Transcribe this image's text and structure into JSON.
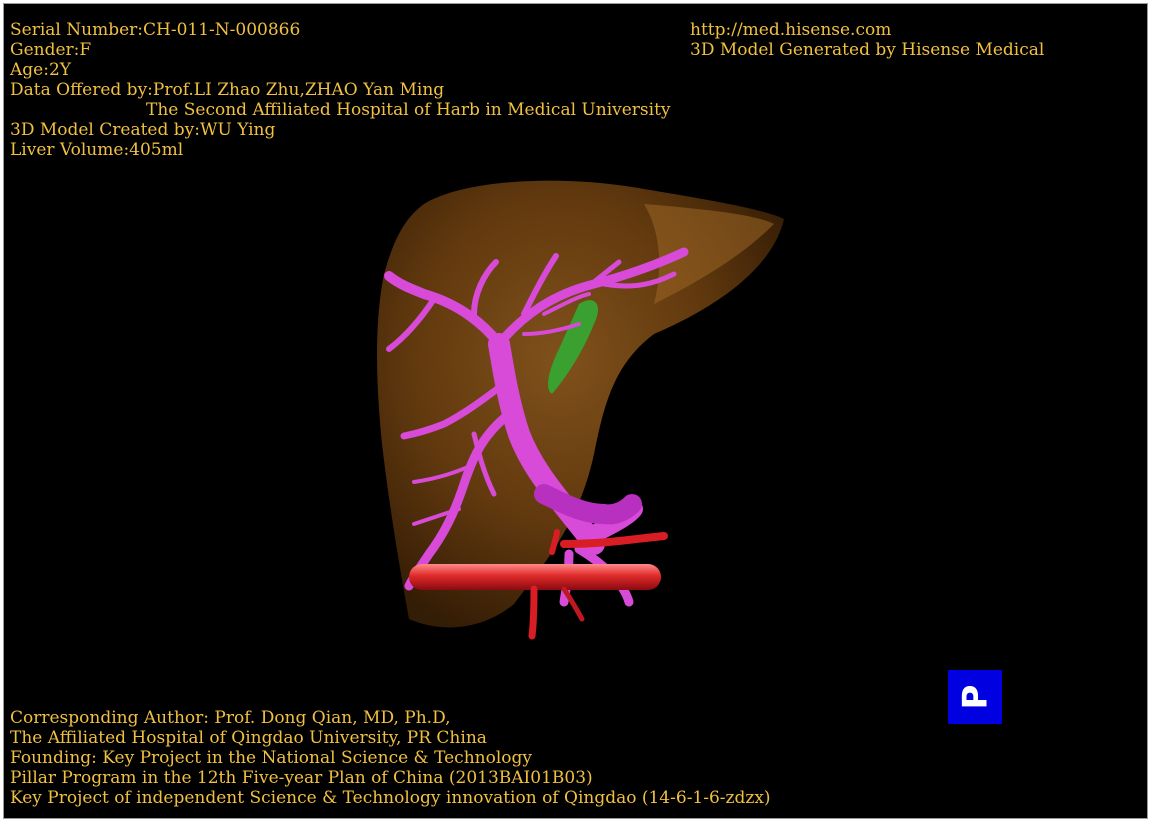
{
  "info_top_left": {
    "serial": "Serial Number:CH-011-N-000866",
    "gender": "Gender:F",
    "age": "Age:2Y",
    "data_offered": "Data Offered by:Prof.LI Zhao Zhu,ZHAO Yan Ming",
    "hospital": "The Second Affiliated Hospital of Harb in Medical University",
    "created_by": "3D Model Created by:WU Ying",
    "liver_volume": "Liver Volume:405ml"
  },
  "info_top_right": {
    "url": "http://med.hisense.com",
    "generated_by": "3D Model Generated by Hisense Medical"
  },
  "info_bottom_left": {
    "author": "Corresponding Author: Prof. Dong Qian, MD, Ph.D,",
    "affiliation": "The Affiliated Hospital of Qingdao University, PR China",
    "founding": "Founding: Key Project in the National Science & Technology",
    "pillar": "Pillar Program in the 12th Five-year Plan of China (2013BAI01B03)",
    "key_project": "Key Project of independent Science & Technology innovation of Qingdao (14-6-1-6-zdzx)"
  },
  "orientation": {
    "label": "P"
  },
  "colors": {
    "background": "#000000",
    "overlay_text": "#f0c040",
    "liver": "#7a4a14",
    "portal_vein": "#d84ad8",
    "artery": "#d81e24",
    "gallbladder": "#3aa030",
    "orientation_box": "#0000e0"
  },
  "icons": {
    "orientation": "orientation-cube-icon"
  }
}
